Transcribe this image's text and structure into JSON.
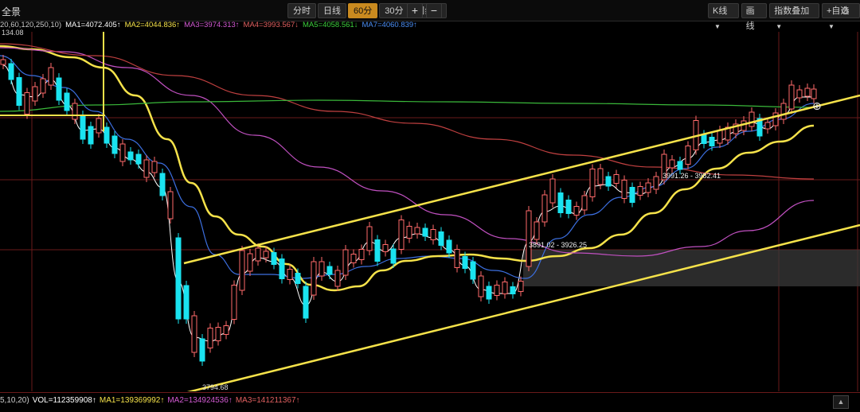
{
  "header": {
    "title": "全景",
    "periods": [
      {
        "label": "分时",
        "active": false
      },
      {
        "label": "日线",
        "active": false
      },
      {
        "label": "60分",
        "active": true
      },
      {
        "label": "30分",
        "active": false
      },
      {
        "label": "周线",
        "active": false,
        "dropdown": true
      }
    ],
    "zoom_in": "+",
    "zoom_out": "−",
    "right_buttons": [
      {
        "label": "K线",
        "dropdown": true
      },
      {
        "label": "画线",
        "dropdown": false
      },
      {
        "label": "指数叠加",
        "dropdown": true
      },
      {
        "label": "+自选",
        "dropdown": true
      }
    ],
    "settings_icon": "gear-icon"
  },
  "ma_legend": {
    "params": "20,60,120,250,10)",
    "items": [
      {
        "text": "MA1=4072.405↑",
        "color": "#ffffff"
      },
      {
        "text": "MA2=4044.836↑",
        "color": "#f5e24a"
      },
      {
        "text": "MA3=3974.313↑",
        "color": "#d25ad2"
      },
      {
        "text": "MA4=3993.567↓",
        "color": "#e06060"
      },
      {
        "text": "MA5=4058.561↓",
        "color": "#3ccf3c"
      },
      {
        "text": "MA7=4060.839↑",
        "color": "#4a8ef5"
      }
    ]
  },
  "price_high_label": "134.08",
  "annotations": {
    "low": "3794.68",
    "range1": "3891.02 - 3926.25",
    "range2": "3991.26 - 3982.41"
  },
  "volume": {
    "params": "5,10,20)",
    "items": [
      {
        "text": "VOL=112359908↑",
        "color": "#ffffff"
      },
      {
        "text": "MA1=139369992↑",
        "color": "#f5e24a"
      },
      {
        "text": "MA2=134924536↑",
        "color": "#d25ad2"
      },
      {
        "text": "MA3=141211367↑",
        "color": "#e06060"
      }
    ]
  },
  "colors": {
    "up": "#ff6a6a",
    "down": "#1ae3f0",
    "trend": "#f5e24a",
    "ma_white": "#ffffff",
    "ma_yellow": "#f5e24a",
    "ma_blue": "#3c6fe0",
    "ma_magenta": "#c050c0",
    "ma_red": "#c04040",
    "ma_green": "#3ab83a",
    "grid": "#6a1a1a"
  }
}
